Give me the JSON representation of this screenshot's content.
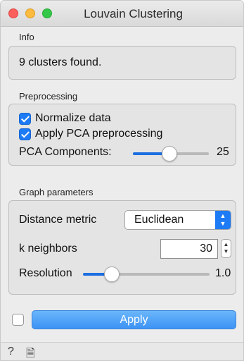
{
  "window": {
    "title": "Louvain Clustering"
  },
  "info": {
    "section_label": "Info",
    "text": "9 clusters found."
  },
  "preprocessing": {
    "section_label": "Preprocessing",
    "normalize_label": "Normalize data",
    "normalize_checked": true,
    "pca_label": "Apply PCA preprocessing",
    "pca_checked": true,
    "pca_components_label": "PCA Components:",
    "pca_components_value": "25",
    "pca_slider_fraction": 0.48
  },
  "graph": {
    "section_label": "Graph parameters",
    "distance_label": "Distance metric",
    "distance_value": "Euclidean",
    "k_label": "k neighbors",
    "k_value": "30",
    "resolution_label": "Resolution",
    "resolution_value": "1.0",
    "resolution_slider_fraction": 0.23
  },
  "footer": {
    "auto_checked": false,
    "apply_label": "Apply"
  },
  "statusbar": {
    "help_icon": "question-mark-icon",
    "report_icon": "document-icon"
  },
  "colors": {
    "accent": "#1d7bf5",
    "apply_button": "#4a9ff7"
  }
}
